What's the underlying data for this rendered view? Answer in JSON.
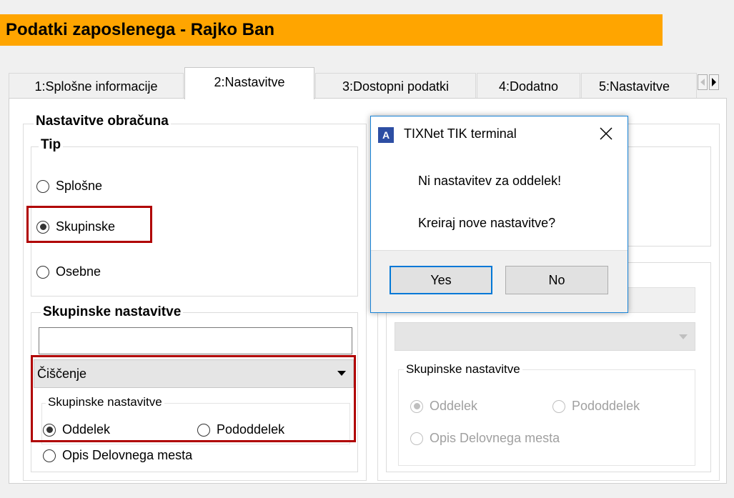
{
  "window": {
    "title": "Podatki zaposlenega - Rajko Ban"
  },
  "tabs": [
    {
      "label": "1:Splošne informacije"
    },
    {
      "label": "2:Nastavitve",
      "active": true
    },
    {
      "label": "3:Dostopni podatki"
    },
    {
      "label": "4:Dodatno"
    },
    {
      "label": "5:Nastavitve"
    }
  ],
  "settings": {
    "group_label": "Nastavitve obračuna",
    "type": {
      "label": "Tip",
      "options": [
        "Splošne",
        "Skupinske",
        "Osebne"
      ],
      "selected": "Skupinske"
    },
    "group_settings": {
      "label": "Skupinske nastavitve",
      "text_value": "",
      "dropdown_value": "Čiščenje",
      "inner_label": "Skupinske nastavitve",
      "options": [
        "Oddelek",
        "Pododdelek",
        "Opis Delovnega mesta"
      ],
      "selected": "Oddelek"
    }
  },
  "right_panel": {
    "inner_label": "Skupinske nastavitve",
    "options": [
      "Oddelek",
      "Pododdelek",
      "Opis Delovnega mesta"
    ],
    "selected": "Oddelek"
  },
  "dialog": {
    "title": "TIXNet TIK terminal",
    "icon_letter": "A",
    "message_line1": "Ni nastavitev za oddelek!",
    "message_line2": "Kreiraj nove nastavitve?",
    "yes_label": "Yes",
    "no_label": "No"
  },
  "colors": {
    "title_bar": "#ffa500",
    "highlight_border": "#b00000",
    "dialog_accent": "#0078d7"
  }
}
